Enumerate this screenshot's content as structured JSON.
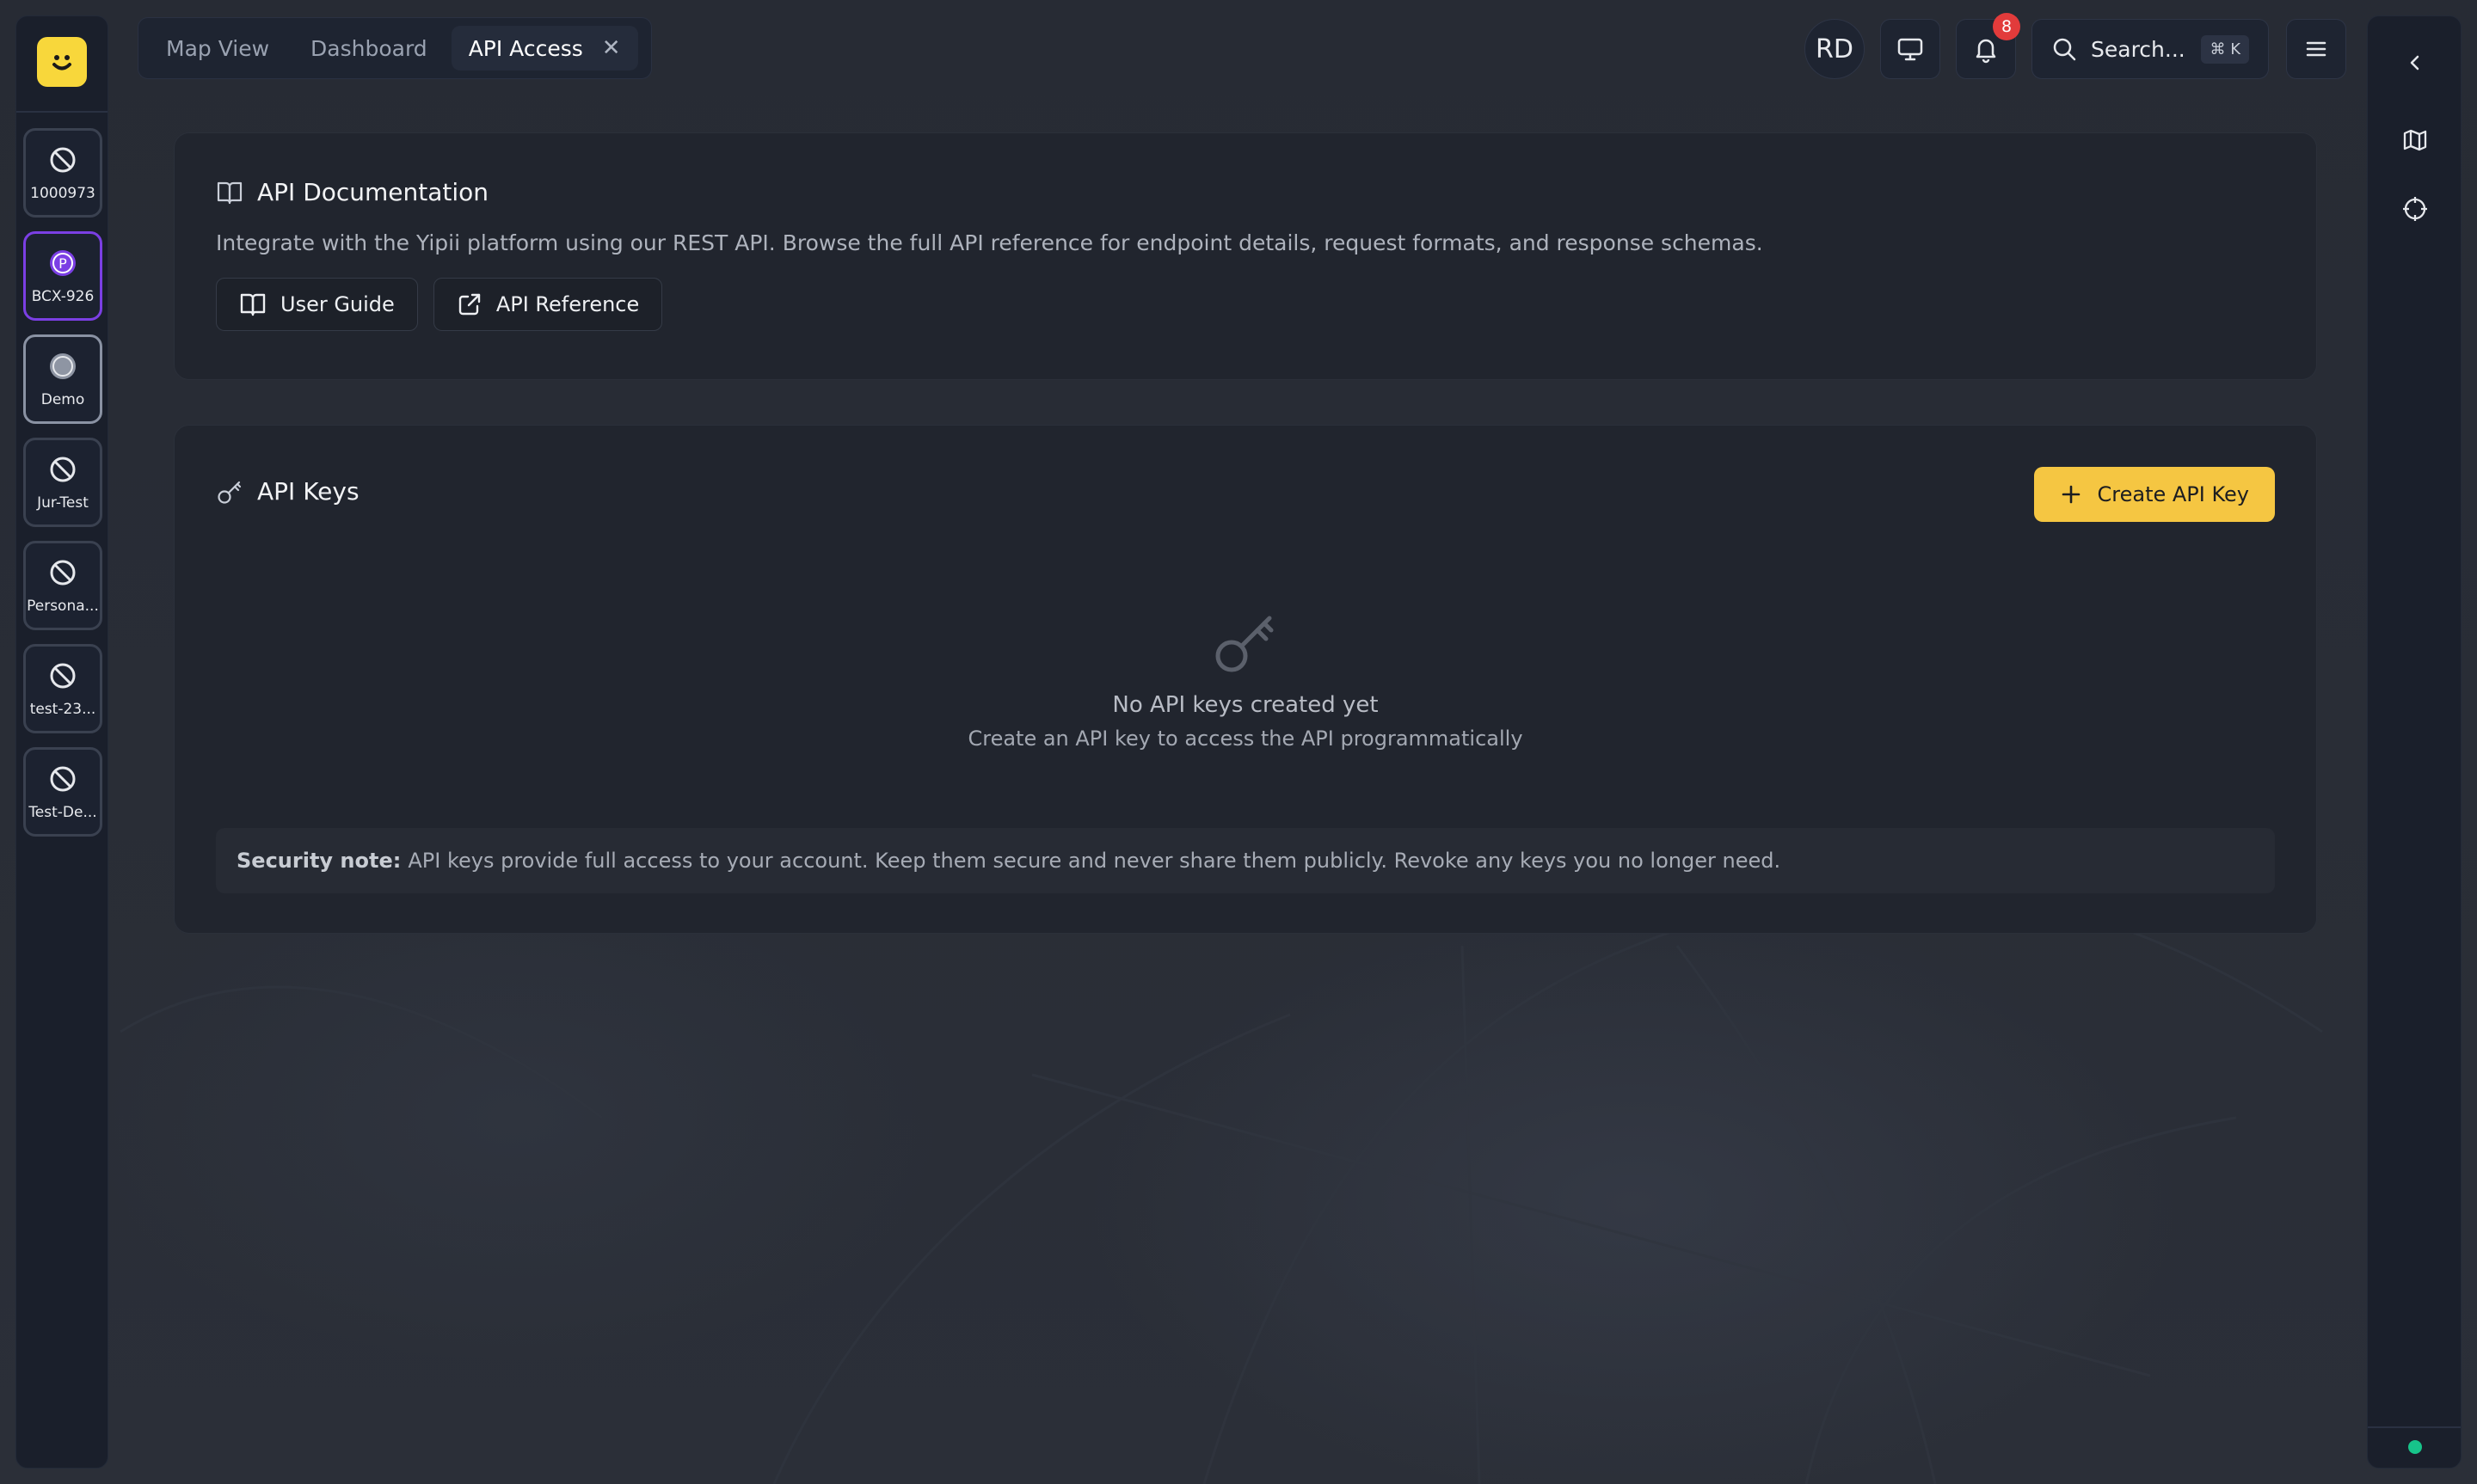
{
  "workspaces": [
    {
      "label": "1000973",
      "icon": "slashed-circle-icon"
    },
    {
      "label": "BCX-926",
      "icon": "p-badge-icon",
      "active": true
    },
    {
      "label": "Demo",
      "icon": "circle-icon"
    },
    {
      "label": "Jur-Test",
      "icon": "slashed-circle-icon"
    },
    {
      "label": "Persona...",
      "icon": "slashed-circle-icon"
    },
    {
      "label": "test-23...",
      "icon": "slashed-circle-icon"
    },
    {
      "label": "Test-De...",
      "icon": "slashed-circle-icon"
    }
  ],
  "tabs": [
    {
      "label": "Map View"
    },
    {
      "label": "Dashboard"
    },
    {
      "label": "API Access",
      "active": true
    }
  ],
  "header": {
    "avatar_initials": "RD",
    "notifications_count": "8",
    "search_placeholder": "Search...",
    "search_shortcut": "⌘ K"
  },
  "docs": {
    "title": "API Documentation",
    "description": "Integrate with the Yipii platform using our REST API. Browse the full API reference for endpoint details, request formats, and response schemas.",
    "user_guide_label": "User Guide",
    "api_reference_label": "API Reference"
  },
  "keys": {
    "title": "API Keys",
    "create_label": "Create API Key",
    "empty_title": "No API keys created yet",
    "empty_subtitle": "Create an API key to access the API programmatically",
    "security_label": "Security note:",
    "security_text": "API keys provide full access to your account. Keep them secure and never share them publicly. Revoke any keys you no longer need."
  },
  "colors": {
    "brand_yellow": "#f8d73b",
    "accent_purple": "#7b3fe4",
    "badge_red": "#e23b3b",
    "status_green": "#17c48a"
  }
}
